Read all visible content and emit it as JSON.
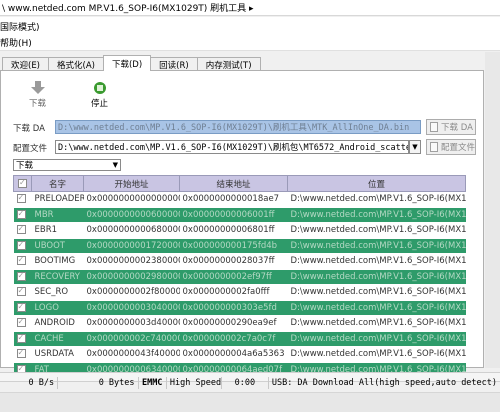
{
  "titlebar": {
    "text": "\\ www.netded.com  MP.V1.6_SOP-I6(MX1029T)  刷机工具  ▸"
  },
  "modebar": {
    "label": "国际模式)"
  },
  "menubar": {
    "help": "帮助(H)"
  },
  "tabs": [
    {
      "label": "欢迎(E)",
      "active": false
    },
    {
      "label": "格式化(A)",
      "active": false
    },
    {
      "label": "下载(D)",
      "active": true
    },
    {
      "label": "回读(R)",
      "active": false
    },
    {
      "label": "内存测试(T)",
      "active": false
    }
  ],
  "toolbar": {
    "download_label": "下载",
    "stop_label": "停止"
  },
  "fields": {
    "download_da_label": "下载 DA",
    "download_da_value": "D:\\www.netded.com\\MP.V1.6_SOP-I6(MX1029T)\\刷机工具\\MTK_AllInOne_DA.bin",
    "download_da_button": "下载 DA",
    "scatter_label": "配置文件",
    "scatter_value": "D:\\www.netded.com\\MP.V1.6_SOP-I6(MX1029T)\\刷机包\\MT6572_Android_scatter.txt",
    "scatter_button": "配置文件"
  },
  "mode_select": {
    "value": "下载"
  },
  "table": {
    "headers": [
      "",
      "名字",
      "开始地址",
      "结束地址",
      "位置"
    ],
    "rows": [
      {
        "name": "PRELOADER",
        "start": "0x0000000000000000",
        "end": "0x0000000000018ae7",
        "loc": "D:\\www.netded.com\\MP.V1.6_SOP-I6(MX1",
        "style": "white"
      },
      {
        "name": "MBR",
        "start": "0x0000000000600000",
        "end": "0x00000000006001ff",
        "loc": "D:\\www.netded.com\\MP.V1.6_SOP-I6(MX1",
        "style": "green"
      },
      {
        "name": "EBR1",
        "start": "0x0000000000680000",
        "end": "0x00000000006801ff",
        "loc": "D:\\www.netded.com\\MP.V1.6_SOP-I6(MX1",
        "style": "white"
      },
      {
        "name": "UBOOT",
        "start": "0x0000000001720000",
        "end": "0x000000000175fd4b",
        "loc": "D:\\www.netded.com\\MP.V1.6_SOP-I6(MX1",
        "style": "green"
      },
      {
        "name": "BOOTIMG",
        "start": "0x0000000002380000",
        "end": "0x00000000028037ff",
        "loc": "D:\\www.netded.com\\MP.V1.6_SOP-I6(MX1",
        "style": "white"
      },
      {
        "name": "RECOVERY",
        "start": "0x0000000002980000",
        "end": "0x0000000002ef97ff",
        "loc": "D:\\www.netded.com\\MP.V1.6_SOP-I6(MX1",
        "style": "green"
      },
      {
        "name": "SEC_RO",
        "start": "0x0000000002f80000",
        "end": "0x0000000002fa0fff",
        "loc": "D:\\www.netded.com\\MP.V1.6_SOP-I6(MX1",
        "style": "white"
      },
      {
        "name": "LOGO",
        "start": "0x0000000003040000",
        "end": "0x000000000303e5fd",
        "loc": "D:\\www.netded.com\\MP.V1.6_SOP-I6(MX1",
        "style": "green"
      },
      {
        "name": "ANDROID",
        "start": "0x0000000003d40000",
        "end": "0x00000000290ea9ef",
        "loc": "D:\\www.netded.com\\MP.V1.6_SOP-I6(MX1",
        "style": "white"
      },
      {
        "name": "CACHE",
        "start": "0x000000002c740000",
        "end": "0x000000002c7a0c7f",
        "loc": "D:\\www.netded.com\\MP.V1.6_SOP-I6(MX1",
        "style": "green"
      },
      {
        "name": "USRDATA",
        "start": "0x0000000043f40000",
        "end": "0x0000000004a6a5363",
        "loc": "D:\\www.netded.com\\MP.V1.6_SOP-I6(MX1",
        "style": "white"
      },
      {
        "name": "FAT",
        "start": "0x0000000006340000",
        "end": "0x00000000064aed07f",
        "loc": "D:\\www.netded.com\\MP.V1.6_SOP-I6(MX1",
        "style": "green"
      }
    ]
  },
  "status": {
    "speed": "0 B/s",
    "bytes": "0 Bytes",
    "storage": "EMMC",
    "usb_speed": "High Speed",
    "time": "0:00",
    "message": "USB: DA Download All(high speed,auto detect)"
  },
  "colors": {
    "row_green": "#2e9b6a",
    "header_bg": "#c9c5e3",
    "path_border": "#7a9cc4"
  },
  "icons": {
    "download": "download-arrow-icon",
    "stop": "stop-icon"
  }
}
